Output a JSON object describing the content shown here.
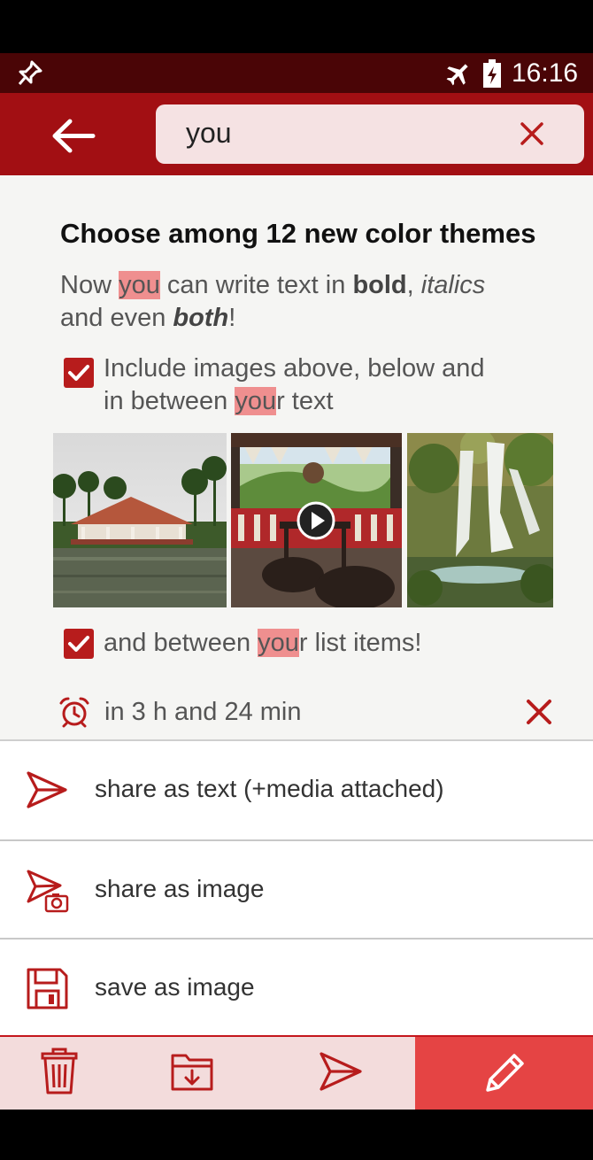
{
  "status_bar": {
    "time": "16:16",
    "icons": [
      "pin-icon",
      "airplane-mode-icon",
      "battery-charging-icon"
    ]
  },
  "app_bar": {
    "search_query": "you",
    "back_icon": "arrow-left-icon",
    "clear_icon": "close-icon"
  },
  "note": {
    "title": "Choose among 12 new color themes",
    "paragraph": {
      "line1_a": "Now ",
      "line1_hl": "you",
      "line1_b": " can write text in ",
      "line1_bold": "bold",
      "line1_c": ", ",
      "line1_italic": "italics",
      "line2_a": "and even ",
      "line2_bolditalic": "both",
      "line2_b": "!"
    },
    "checklist_1": {
      "line1": "Include images above, below and",
      "line2_a": "in between ",
      "line2_hl": "you",
      "line2_b": "r text"
    },
    "images": [
      "gazebo-on-lake-photo",
      "veranda-video-thumbnail",
      "waterfall-photo"
    ],
    "checklist_2": {
      "a": "and between ",
      "hl": "you",
      "b": "r list items!"
    },
    "reminder": "in 3 h and 24 min"
  },
  "share_sheet": [
    {
      "label": "share as text (+media attached)",
      "icon": "send-icon"
    },
    {
      "label": "share as image",
      "icon": "send-image-icon"
    },
    {
      "label": "save as image",
      "icon": "save-floppy-icon"
    }
  ],
  "bottom_bar": [
    "trash-icon",
    "folder-icon",
    "send-icon",
    "edit-pencil-icon"
  ],
  "colors": {
    "primary": "#a20f13",
    "status_bar": "#4a0506",
    "highlight": "#ef8f8f",
    "accent": "#e54444",
    "check": "#b71c1c"
  }
}
